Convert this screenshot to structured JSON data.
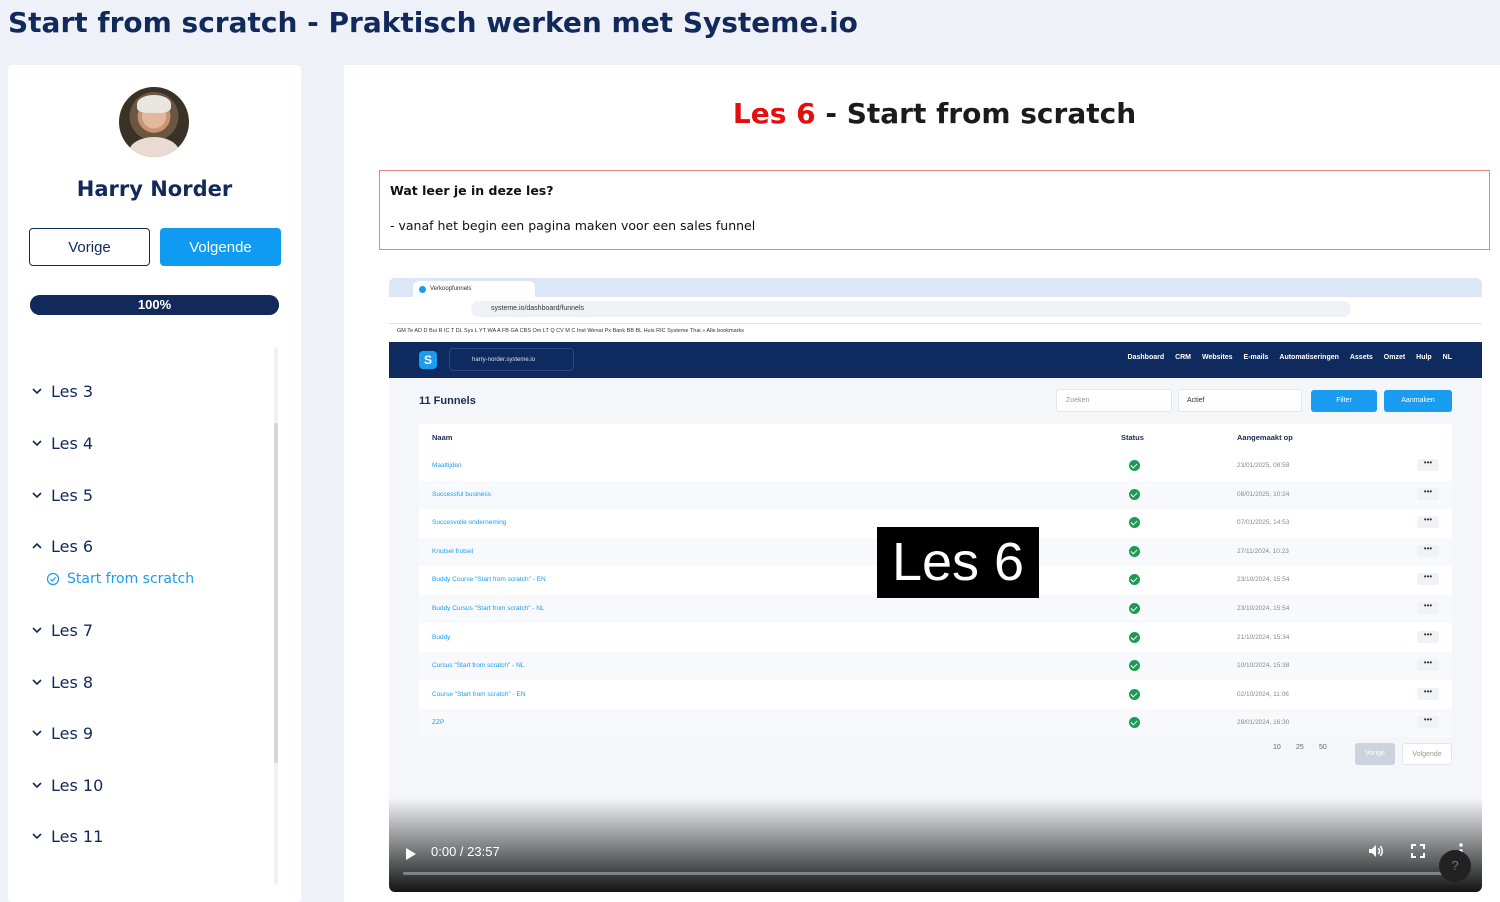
{
  "page": {
    "title": "Start from scratch - Praktisch werken met Systeme.io"
  },
  "sidebar": {
    "teacher_name": "Harry Norder",
    "prev_label": "Vorige",
    "next_label": "Volgende",
    "progress": {
      "label": "100%",
      "value": 1.0
    },
    "lessons": [
      {
        "label": "Les 3",
        "expanded": false
      },
      {
        "label": "Les 4",
        "expanded": false
      },
      {
        "label": "Les 5",
        "expanded": false
      },
      {
        "label": "Les 6",
        "expanded": true,
        "sub_items": [
          {
            "label": "Start from scratch",
            "completed": true
          }
        ]
      },
      {
        "label": "Les 7",
        "expanded": false
      },
      {
        "label": "Les 8",
        "expanded": false
      },
      {
        "label": "Les 9",
        "expanded": false
      },
      {
        "label": "Les 10",
        "expanded": false
      },
      {
        "label": "Les 11",
        "expanded": false
      }
    ]
  },
  "main": {
    "lesson_prefix": "Les 6",
    "lesson_title": " - Start from scratch",
    "info_question": "Wat leer je in deze les?",
    "info_answer": "- vanaf het begin een pagina maken voor een sales funnel"
  },
  "video": {
    "overlay_label": "Les 6",
    "time": "0:00 / 23:57",
    "progress": 0.0,
    "screen": {
      "tab_title": "Verkoopfunnels",
      "url": "systeme.io/dashboard/funnels",
      "bookmarks": "GM   Te   AD   D   Bui   R   IC   T   DL   Sys   L   YT   WA   A   FB   GA   CBS   Om   LT   Q   CV   M   C   Inst   Wenat   Px   Bank   BB   BL   Huis   RIC   Systeme   Thai   »   Alle bookmarks",
      "account": "harry-norder.systeme.io",
      "nav": [
        "Dashboard",
        "CRM",
        "Websites",
        "E-mails",
        "Automatiseringen",
        "Assets",
        "Omzet",
        "Hulp",
        "NL"
      ],
      "funnels_title": "11 Funnels",
      "search_placeholder": "Zoeken",
      "filter_select": "Actief",
      "filter_button": "Filter",
      "create_button": "Aanmaken",
      "columns": [
        "Naam",
        "Status",
        "Aangemaakt op"
      ],
      "rows": [
        {
          "name": "Maaltijden",
          "date": "23/01/2025, 08:58"
        },
        {
          "name": "Successful business",
          "date": "08/01/2025, 10:24"
        },
        {
          "name": "Succesvolle onderneming",
          "date": "07/01/2025, 14:53"
        },
        {
          "name": "Knutsel frutsel",
          "date": "27/11/2024, 10:23"
        },
        {
          "name": "Buddy Course \"Start from scratch\" - EN",
          "date": "23/10/2024, 15:54"
        },
        {
          "name": "Buddy Cursus \"Start from scratch\" - NL",
          "date": "23/10/2024, 15:54"
        },
        {
          "name": "Buddy",
          "date": "21/10/2024, 15:34"
        },
        {
          "name": "Cursus \"Start from scratch\" - NL",
          "date": "10/10/2024, 15:38"
        },
        {
          "name": "Course \"Start from scratch\" - EN",
          "date": "02/10/2024, 11:06"
        },
        {
          "name": "ZZP",
          "date": "28/01/2024, 16:30"
        }
      ],
      "row_menu": "•••",
      "page_sizes": [
        "10",
        "25",
        "50"
      ],
      "pager_prev": "Vorige",
      "pager_next": "Volgende"
    },
    "help": "?"
  }
}
